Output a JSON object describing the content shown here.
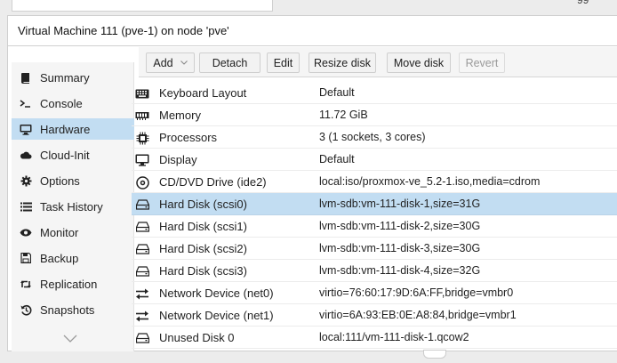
{
  "window": {
    "title": "Virtual Machine 111 (pve-1) on node 'pve'"
  },
  "nav": {
    "items": [
      {
        "label": "Summary",
        "icon": "book-icon"
      },
      {
        "label": "Console",
        "icon": "terminal-icon"
      },
      {
        "label": "Hardware",
        "icon": "monitor-icon",
        "active": true
      },
      {
        "label": "Cloud-Init",
        "icon": "cloud-icon"
      },
      {
        "label": "Options",
        "icon": "gear-icon"
      },
      {
        "label": "Task History",
        "icon": "list-icon"
      },
      {
        "label": "Monitor",
        "icon": "eye-icon"
      },
      {
        "label": "Backup",
        "icon": "floppy-icon"
      },
      {
        "label": "Replication",
        "icon": "retweet-icon"
      },
      {
        "label": "Snapshots",
        "icon": "history-icon"
      }
    ]
  },
  "toolbar": {
    "add": "Add",
    "detach": "Detach",
    "edit": "Edit",
    "resize": "Resize disk",
    "move": "Move disk",
    "revert": "Revert"
  },
  "hardware": [
    {
      "name": "Keyboard Layout",
      "value": "Default",
      "icon": "keyboard-icon"
    },
    {
      "name": "Memory",
      "value": "11.72 GiB",
      "icon": "memory-icon"
    },
    {
      "name": "Processors",
      "value": "3 (1 sockets, 3 cores)",
      "icon": "cpu-icon"
    },
    {
      "name": "Display",
      "value": "Default",
      "icon": "desktop-icon"
    },
    {
      "name": "CD/DVD Drive (ide2)",
      "value": "local:iso/proxmox-ve_5.2-1.iso,media=cdrom",
      "icon": "cdrom-icon"
    },
    {
      "name": "Hard Disk (scsi0)",
      "value": "lvm-sdb:vm-111-disk-1,size=31G",
      "icon": "harddisk-icon",
      "selected": true
    },
    {
      "name": "Hard Disk (scsi1)",
      "value": "lvm-sdb:vm-111-disk-2,size=30G",
      "icon": "harddisk-icon"
    },
    {
      "name": "Hard Disk (scsi2)",
      "value": "lvm-sdb:vm-111-disk-3,size=30G",
      "icon": "harddisk-icon"
    },
    {
      "name": "Hard Disk (scsi3)",
      "value": "lvm-sdb:vm-111-disk-4,size=32G",
      "icon": "harddisk-icon"
    },
    {
      "name": "Network Device (net0)",
      "value": "virtio=76:60:17:9D:6A:FF,bridge=vmbr0",
      "icon": "exchange-icon"
    },
    {
      "name": "Network Device (net1)",
      "value": "virtio=6A:93:EB:0E:A8:84,bridge=vmbr1",
      "icon": "exchange-icon"
    },
    {
      "name": "Unused Disk 0",
      "value": "local:111/vm-111-disk-1.qcow2",
      "icon": "harddisk-icon"
    }
  ],
  "colors": {
    "selection": "#c2ddf2",
    "toolbar_bg": "#f5f5f5",
    "nav_bg": "#f5f5f5"
  }
}
